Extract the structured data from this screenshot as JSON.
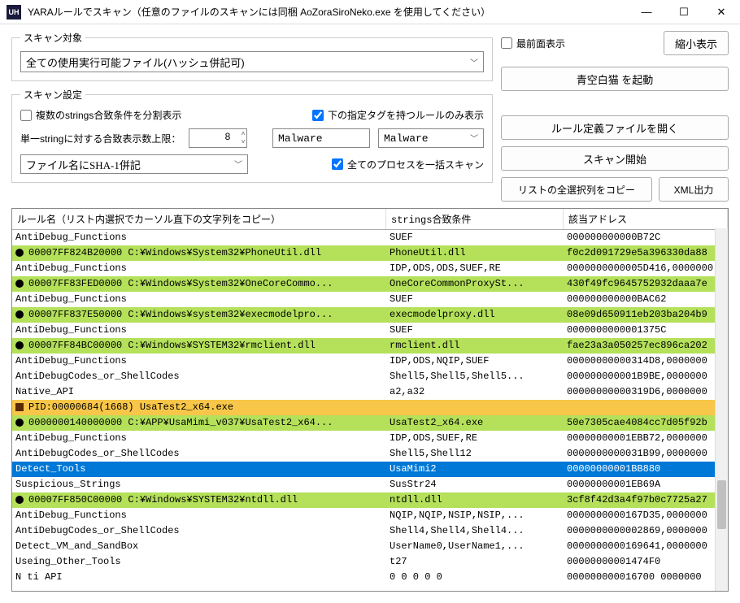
{
  "window": {
    "icon_text": "UH",
    "title": "YARAルールでスキャン（任意のファイルのスキャンには同梱 AoZoraSiroNeko.exe を使用してください）"
  },
  "scan_target": {
    "legend": "スキャン対象",
    "value": "全ての使用実行可能ファイル(ハッシュ併記可)"
  },
  "scan_settings": {
    "legend": "スキャン設定",
    "split_display": "複数のstrings合致条件を分割表示",
    "tag_only": "下の指定タグを持つルールのみ表示",
    "single_string_label": "単一stringに対する合致表示数上限：",
    "single_string_value": "8",
    "tag1": "Malware",
    "tag2": "Malware",
    "file_sha1": "ファイル名にSHA-1併記",
    "all_process": "全てのプロセスを一括スキャン"
  },
  "right": {
    "topmost": "最前面表示",
    "shrink": "縮小表示",
    "launch": "青空白猫 を起動",
    "open_rule": "ルール定義ファイルを開く",
    "start_scan": "スキャン開始",
    "copy_cols": "リストの全選択列をコピー",
    "xml_out": "XML出力"
  },
  "table": {
    "h1": "ルール名（リスト内選択でカーソル直下の文字列をコピー）",
    "h2": "strings合致条件",
    "h3": "該当アドレス",
    "rows": [
      {
        "c": "",
        "b": "",
        "r": "AntiDebug_Functions",
        "s": "SUEF",
        "a": "000000000000B72C"
      },
      {
        "c": "green",
        "b": "dot",
        "r": "00007FF824B20000  C:¥Windows¥System32¥PhoneUtil.dll",
        "s": "PhoneUtil.dll",
        "a": "f0c2d091729e5a396330da88"
      },
      {
        "c": "",
        "b": "",
        "r": "AntiDebug_Functions",
        "s": "IDP,ODS,ODS,SUEF,RE",
        "a": "0000000000005D416,0000000"
      },
      {
        "c": "green",
        "b": "dot",
        "r": "00007FF83FED0000  C:¥Windows¥System32¥OneCoreCommo...",
        "s": "OneCoreCommonProxySt...",
        "a": "430f49fc9645752932daaa7e"
      },
      {
        "c": "",
        "b": "",
        "r": "AntiDebug_Functions",
        "s": "SUEF",
        "a": "000000000000BAC62"
      },
      {
        "c": "green",
        "b": "dot",
        "r": "00007FF837E50000  C:¥Windows¥system32¥execmodelpro...",
        "s": "execmodelproxy.dll",
        "a": "08e09d650911eb203ba204b9"
      },
      {
        "c": "",
        "b": "",
        "r": "AntiDebug_Functions",
        "s": "SUEF",
        "a": "0000000000001375C"
      },
      {
        "c": "green",
        "b": "dot",
        "r": "00007FF84BC00000  C:¥Windows¥SYSTEM32¥rmclient.dll",
        "s": "rmclient.dll",
        "a": "fae23a3a050257ec896ca202"
      },
      {
        "c": "",
        "b": "",
        "r": "AntiDebug_Functions",
        "s": "IDP,ODS,NQIP,SUEF",
        "a": "00000000000314D8,0000000"
      },
      {
        "c": "",
        "b": "",
        "r": "AntiDebugCodes_or_ShellCodes",
        "s": "Shell5,Shell5,Shell5...",
        "a": "000000000001B9BE,0000000"
      },
      {
        "c": "",
        "b": "",
        "r": "Native_API",
        "s": "a2,a32",
        "a": "00000000000319D6,0000000"
      },
      {
        "c": "orange",
        "b": "sq",
        "r": "PID:00000684(1668)  UsaTest2_x64.exe",
        "s": "",
        "a": ""
      },
      {
        "c": "green",
        "b": "dot",
        "r": "0000000140000000  C:¥APP¥UsaMimi_v037¥UsaTest2_x64...",
        "s": "UsaTest2_x64.exe",
        "a": "50e7305cae4084cc7d05f92b"
      },
      {
        "c": "",
        "b": "",
        "r": "AntiDebug_Functions",
        "s": "IDP,ODS,SUEF,RE",
        "a": "00000000001EBB72,0000000"
      },
      {
        "c": "",
        "b": "",
        "r": "AntiDebugCodes_or_ShellCodes",
        "s": "Shell5,Shell12",
        "a": "0000000000031B99,0000000"
      },
      {
        "c": "blue",
        "b": "",
        "r": "Detect_Tools",
        "s": "UsaMimi2",
        "a": "00000000001BB880"
      },
      {
        "c": "",
        "b": "",
        "r": "Suspicious_Strings",
        "s": "SusStr24",
        "a": "00000000001EB69A"
      },
      {
        "c": "green",
        "b": "dot",
        "r": "00007FF850C00000  C:¥Windows¥SYSTEM32¥ntdll.dll",
        "s": "ntdll.dll",
        "a": "3cf8f42d3a4f97b0c7725a27"
      },
      {
        "c": "",
        "b": "",
        "r": "AntiDebug_Functions",
        "s": "NQIP,NQIP,NSIP,NSIP,...",
        "a": "0000000000167D35,0000000"
      },
      {
        "c": "",
        "b": "",
        "r": "AntiDebugCodes_or_ShellCodes",
        "s": "Shell4,Shell4,Shell4...",
        "a": "0000000000002869,0000000"
      },
      {
        "c": "",
        "b": "",
        "r": "Detect_VM_and_SandBox",
        "s": "UserName0,UserName1,...",
        "a": "0000000000169641,0000000"
      },
      {
        "c": "",
        "b": "",
        "r": "Useing_Other_Tools",
        "s": "t27",
        "a": "00000000001474F0"
      },
      {
        "c": "",
        "b": "",
        "r": "N ti    API",
        "s": "   0  0  0  0  0",
        "a": "000000000016700  0000000"
      }
    ]
  }
}
